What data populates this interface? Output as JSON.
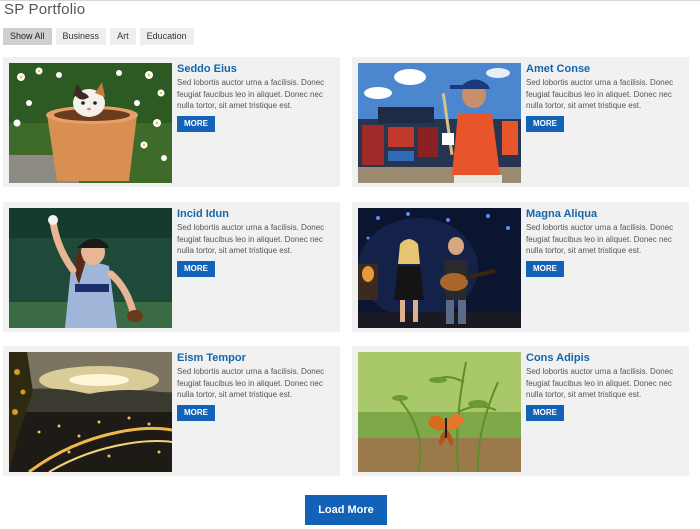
{
  "page": {
    "title": "SP Portfolio"
  },
  "filters": [
    {
      "label": "Show All"
    },
    {
      "label": "Business"
    },
    {
      "label": "Art"
    },
    {
      "label": "Education"
    }
  ],
  "cards": [
    {
      "title": "Seddo Eius",
      "text": "Sed lobortis auctor urna a facilisis. Donec feugiat faucibus leo in aliquet. Donec nec nulla tortor, sit amet tristique est.",
      "button": "MORE"
    },
    {
      "title": "Amet Conse",
      "text": "Sed lobortis auctor urna a facilisis. Donec feugiat faucibus leo in aliquet. Donec nec nulla tortor, sit amet tristique est.",
      "button": "MORE"
    },
    {
      "title": "Incid Idun",
      "text": "Sed lobortis auctor urna a facilisis. Donec feugiat faucibus leo in aliquet. Donec nec nulla tortor, sit amet tristique est.",
      "button": "MORE"
    },
    {
      "title": "Magna Aliqua",
      "text": "Sed lobortis auctor urna a facilisis. Donec feugiat faucibus leo in aliquet. Donec nec nulla tortor, sit amet tristique est.",
      "button": "MORE"
    },
    {
      "title": "Eism Tempor",
      "text": "Sed lobortis auctor urna a facilisis. Donec feugiat faucibus leo in aliquet. Donec nec nulla tortor, sit amet tristique est.",
      "button": "MORE"
    },
    {
      "title": "Cons Adipis",
      "text": "Sed lobortis auctor urna a facilisis. Donec feugiat faucibus leo in aliquet. Donec nec nulla tortor, sit amet tristique est.",
      "button": "MORE"
    }
  ],
  "load_more": {
    "label": "Load More"
  },
  "colors": {
    "accent": "#1262b8",
    "title_link": "#1565a8",
    "card_bg": "#f1f1f1"
  }
}
